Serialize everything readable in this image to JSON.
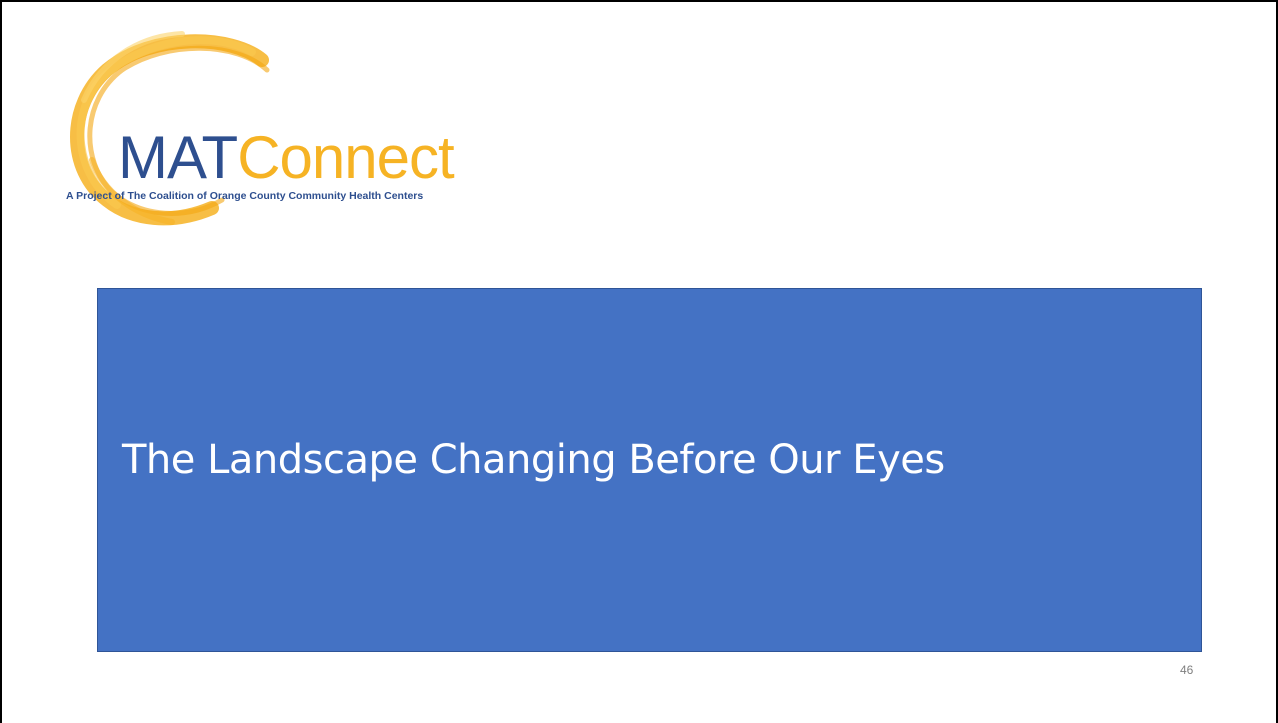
{
  "logo": {
    "brand_mat": "MAT",
    "brand_connect": "Connect",
    "tagline": "A Project of The Coalition of Orange County Community Health Centers",
    "ring_color": "#f6b324",
    "mat_color": "#2e4f8f"
  },
  "slide": {
    "title": "The Landscape Changing Before Our Eyes",
    "title_box_color": "#4472c4",
    "number": "46"
  }
}
